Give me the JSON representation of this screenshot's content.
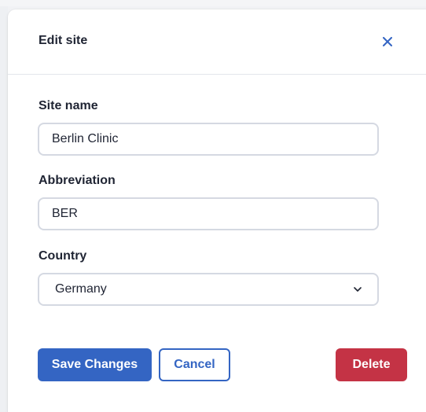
{
  "modal": {
    "title": "Edit site"
  },
  "form": {
    "site_name": {
      "label": "Site name",
      "value": "Berlin Clinic"
    },
    "abbreviation": {
      "label": "Abbreviation",
      "value": "BER"
    },
    "country": {
      "label": "Country",
      "value": "Germany"
    }
  },
  "actions": {
    "save_label": "Save Changes",
    "cancel_label": "Cancel",
    "delete_label": "Delete"
  },
  "icons": {
    "close": "close-icon",
    "dropdown": "chevron-down-icon"
  },
  "colors": {
    "primary": "#3465c3",
    "danger": "#c43345",
    "text": "#1f2433",
    "border": "#d5d9e2"
  }
}
